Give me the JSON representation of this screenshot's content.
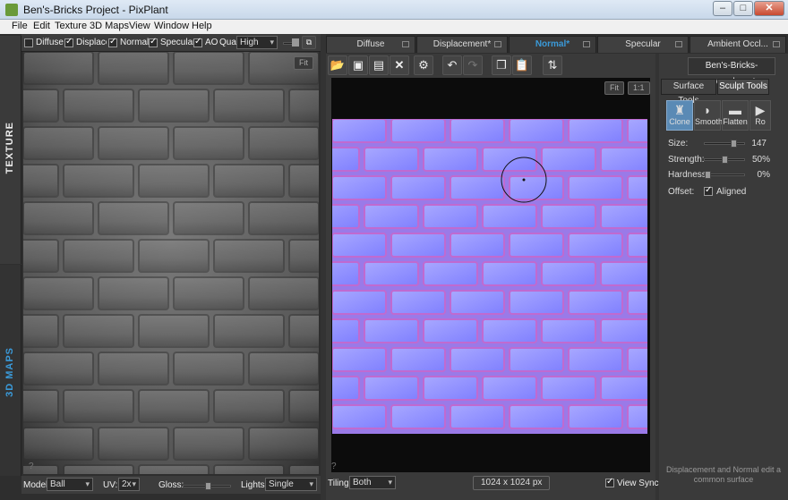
{
  "window": {
    "title": "Ben's-Bricks Project - PixPlant",
    "minimize": "–",
    "maximize": "□",
    "close": "✕"
  },
  "menu": [
    "File",
    "Edit",
    "Texture",
    "3D Maps",
    "View",
    "Window",
    "Help"
  ],
  "left_panel": {
    "side_tabs": {
      "texture": "TEXTURE",
      "maps": "3D MAPS"
    },
    "options": {
      "diffuse": {
        "label": "Diffuse",
        "checked": false
      },
      "displacement": {
        "label": "Displacen",
        "checked": true
      },
      "normal": {
        "label": "Normal",
        "checked": true
      },
      "specular": {
        "label": "Specular",
        "checked": true
      },
      "ao": {
        "label": "AO",
        "checked": true
      },
      "quality_label": "Qual",
      "quality_value": "High"
    },
    "fit_label": "Fit",
    "help": "?",
    "bottom": {
      "model_label": "Model:",
      "model_value": "Ball",
      "uv_label": "UV:",
      "uv_value": "2x",
      "gloss_label": "Gloss:",
      "lights_label": "Lights:",
      "lights_value": "Single"
    }
  },
  "tabs": [
    {
      "label": "Diffuse",
      "active": false
    },
    {
      "label": "Displacement*",
      "active": false
    },
    {
      "label": "Normal*",
      "active": true
    },
    {
      "label": "Specular",
      "active": false
    },
    {
      "label": "Ambient Occl...",
      "active": false
    }
  ],
  "toolbar_icons": [
    "open-folder-icon",
    "save-icon",
    "save-as-icon",
    "delete-icon",
    "settings-icon",
    "undo-icon",
    "redo-icon",
    "copy-icon",
    "paste-icon",
    "swap-icon"
  ],
  "viewport": {
    "fit_label": "Fit",
    "one_to_one_label": "1:1",
    "help": "?"
  },
  "status": {
    "tiling_label": "Tiling:",
    "tiling_value": "Both",
    "size": "1024 x 1024 px",
    "view_sync_label": "View Sync",
    "view_sync_checked": true
  },
  "right_panel": {
    "filename": "Ben's-Bricks-normal.png*",
    "subtabs": [
      {
        "label": "Surface Tools",
        "active": false
      },
      {
        "label": "Sculpt Tools",
        "active": true
      }
    ],
    "tools": [
      {
        "label": "Clone",
        "active": true
      },
      {
        "label": "Smooth",
        "active": false
      },
      {
        "label": "Flatten",
        "active": false
      },
      {
        "label": "Ro",
        "active": false
      }
    ],
    "size": {
      "label": "Size:",
      "value": "147",
      "level": 0.75
    },
    "strength": {
      "label": "Strength:",
      "value": "50%",
      "level": 0.5
    },
    "hardness": {
      "label": "Hardness:",
      "value": "0%",
      "level": 0.0
    },
    "offset": {
      "label": "Offset:",
      "aligned_label": "Aligned",
      "checked": true
    },
    "hint": "Displacement and Normal edit a common surface"
  },
  "colors": {
    "accent": "#3a9ad9",
    "normal_map_base": "#8080ff",
    "panel": "#3a3a3a"
  }
}
